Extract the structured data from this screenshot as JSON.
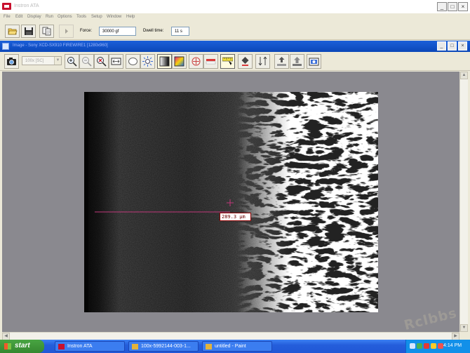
{
  "app": {
    "title": "Instron ATA"
  },
  "menu": [
    "File",
    "Edit",
    "Display",
    "Run",
    "Options",
    "Tools",
    "Setup",
    "Window",
    "Help"
  ],
  "toolbar": {
    "force_label": "Force:",
    "force_value": "30000 gf",
    "dwell_label": "Dwell time:",
    "dwell_value": "11 s"
  },
  "image_window": {
    "title": "Image - Sony XCD-SX910 FIREWIRE1 [1280x960]",
    "zoom_value": "100x [SC]"
  },
  "measurement": {
    "value": "289.3 µm"
  },
  "taskbar": {
    "start_label": "start",
    "tasks": [
      "Instron ATA",
      "100x-5992144-003-1...",
      "untitled - Paint"
    ],
    "clock": "4:14 PM"
  },
  "watermark": "Rclbbs",
  "colors": {
    "taskbar_blue": "#245edb",
    "start_green": "#3c9a35",
    "title_blue": "#0b47b8",
    "measure_line": "#c0387a"
  },
  "icons": [
    "open-folder-icon",
    "save-icon",
    "copy-icon",
    "play-icon",
    "camera-icon",
    "zoom-in-icon",
    "zoom-out-icon",
    "zoom-reset-icon",
    "fit-width-icon",
    "ellipse-icon",
    "brightness-icon",
    "grayscale-icon",
    "color-icon",
    "crosshair-icon",
    "line-measure-icon",
    "ruler-icon",
    "fill-icon",
    "arrow-measure-icon",
    "export-icon",
    "import-icon",
    "snapshot-icon"
  ]
}
